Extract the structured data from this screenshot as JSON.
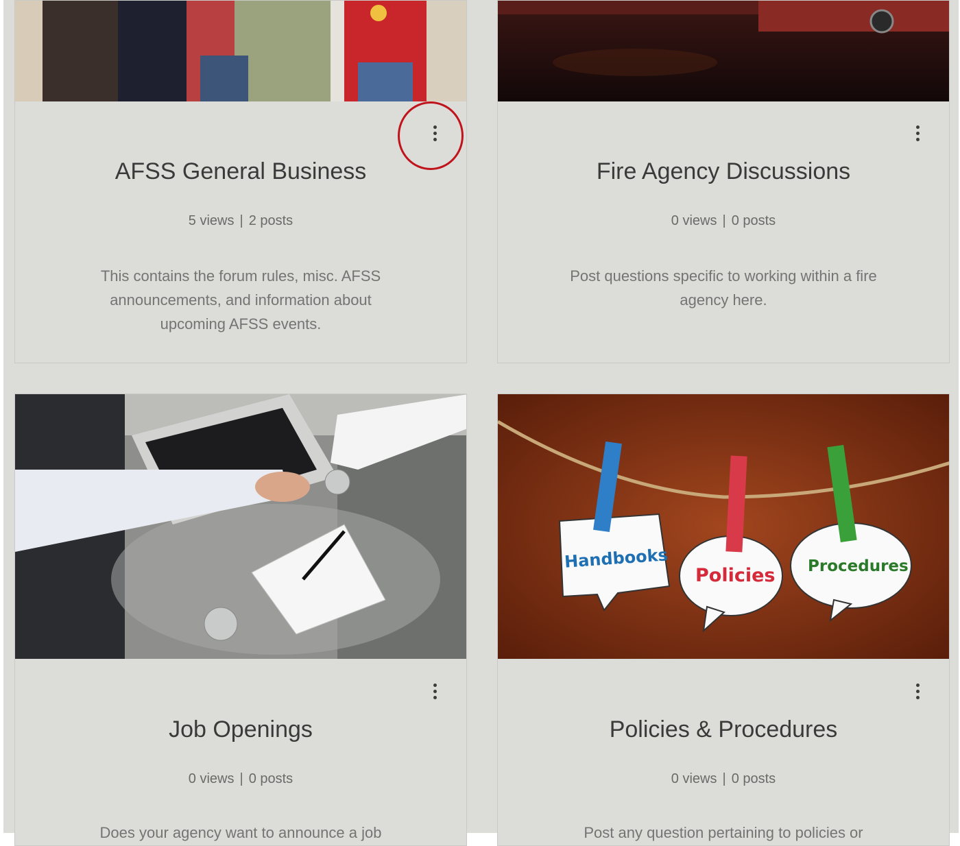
{
  "forums": [
    {
      "title": "AFSS General Business",
      "views": "5 views",
      "separator": "|",
      "posts": "2 posts",
      "description": "This contains the forum rules, misc. AFSS announcements, and information about upcoming AFSS events.",
      "menu_icon": "more-vertical-icon"
    },
    {
      "title": "Fire Agency Discussions",
      "views": "0 views",
      "separator": "|",
      "posts": "0 posts",
      "description": "Post questions specific to working within a fire agency here.",
      "menu_icon": "more-vertical-icon"
    },
    {
      "title": "Job Openings",
      "views": "0 views",
      "separator": "|",
      "posts": "0 posts",
      "description": "Does your agency want to announce a job",
      "menu_icon": "more-vertical-icon"
    },
    {
      "title": "Policies & Procedures",
      "views": "0 views",
      "separator": "|",
      "posts": "0 posts",
      "description": "Post any question pertaining to policies or",
      "menu_icon": "more-vertical-icon",
      "image_labels": {
        "handbooks": "Handbooks",
        "policies": "Policies",
        "procedures": "Procedures"
      }
    }
  ],
  "colors": {
    "background": "#dcdcd8",
    "highlight_ring": "#c0141c",
    "handbooks_text": "#1f6fb3",
    "policies_text": "#d42a3a",
    "procedures_text": "#2a7a2a"
  }
}
